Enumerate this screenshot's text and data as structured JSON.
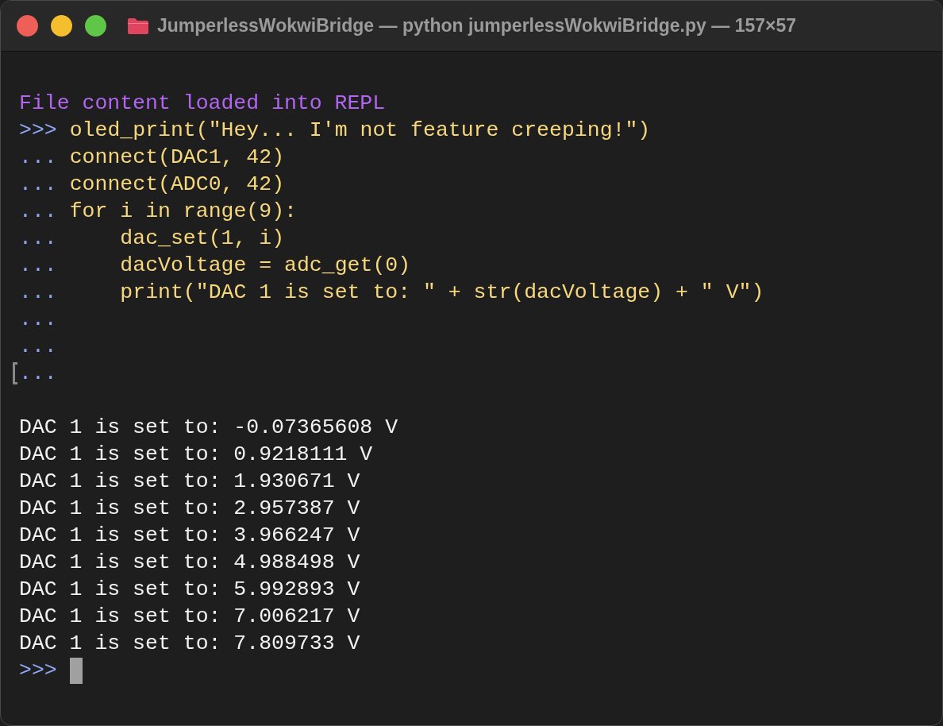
{
  "window": {
    "title": "JumperlessWokwiBridge — python jumperlessWokwiBridge.py — 157×57"
  },
  "terminal": {
    "lines": [
      {
        "kind": "blank"
      },
      {
        "kind": "info",
        "text": "File content loaded into REPL"
      },
      {
        "kind": "input",
        "prompt": ">>>",
        "text": "oled_print(\"Hey... I'm not feature creeping!\")",
        "marked": false
      },
      {
        "kind": "input",
        "prompt": "...",
        "text": "connect(DAC1, 42)",
        "marked": false
      },
      {
        "kind": "input",
        "prompt": "...",
        "text": "connect(ADC0, 42)",
        "marked": false
      },
      {
        "kind": "input",
        "prompt": "...",
        "text": "for i in range(9):",
        "marked": false
      },
      {
        "kind": "input",
        "prompt": "...",
        "text": "    dac_set(1, i)",
        "marked": false
      },
      {
        "kind": "input",
        "prompt": "...",
        "text": "    dacVoltage = adc_get(0)",
        "marked": false
      },
      {
        "kind": "input",
        "prompt": "...",
        "text": "    print(\"DAC 1 is set to: \" + str(dacVoltage) + \" V\")",
        "marked": false
      },
      {
        "kind": "input",
        "prompt": "...",
        "marked": false
      },
      {
        "kind": "input",
        "prompt": "...",
        "marked": false
      },
      {
        "kind": "input",
        "prompt": "...",
        "marked": true
      },
      {
        "kind": "blank"
      },
      {
        "kind": "output",
        "text": "DAC 1 is set to: -0.07365608 V"
      },
      {
        "kind": "output",
        "text": "DAC 1 is set to: 0.9218111 V"
      },
      {
        "kind": "output",
        "text": "DAC 1 is set to: 1.930671 V"
      },
      {
        "kind": "output",
        "text": "DAC 1 is set to: 2.957387 V"
      },
      {
        "kind": "output",
        "text": "DAC 1 is set to: 3.966247 V"
      },
      {
        "kind": "output",
        "text": "DAC 1 is set to: 4.988498 V"
      },
      {
        "kind": "output",
        "text": "DAC 1 is set to: 5.992893 V"
      },
      {
        "kind": "output",
        "text": "DAC 1 is set to: 7.006217 V"
      },
      {
        "kind": "output",
        "text": "DAC 1 is set to: 7.809733 V"
      },
      {
        "kind": "prompt",
        "prompt": ">>>",
        "cursor": true
      }
    ]
  }
}
